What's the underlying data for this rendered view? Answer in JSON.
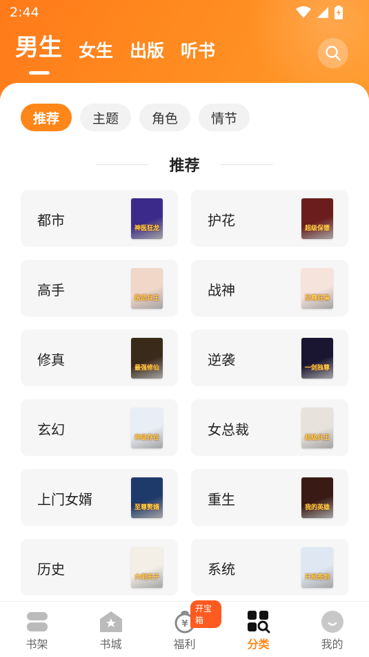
{
  "status": {
    "time": "2:44"
  },
  "tabs": [
    {
      "label": "男生",
      "active": true
    },
    {
      "label": "女生"
    },
    {
      "label": "出版"
    },
    {
      "label": "听书"
    }
  ],
  "chips": [
    {
      "label": "推荐",
      "active": true
    },
    {
      "label": "主题"
    },
    {
      "label": "角色"
    },
    {
      "label": "情节"
    }
  ],
  "section_title": "推荐",
  "categories": [
    {
      "label": "都市",
      "cover_text": "神医狂龙",
      "cover_color": "#3b2a8a"
    },
    {
      "label": "护花",
      "cover_text": "超级保镖",
      "cover_color": "#6b1d1d"
    },
    {
      "label": "高手",
      "cover_text": "医武兵王",
      "cover_color": "#f1d7c8"
    },
    {
      "label": "战神",
      "cover_text": "至尊狂枭",
      "cover_color": "#f6e3dc"
    },
    {
      "label": "修真",
      "cover_text": "最强修仙",
      "cover_color": "#3a2a1a"
    },
    {
      "label": "逆袭",
      "cover_text": "一剑独尊",
      "cover_color": "#1a1530"
    },
    {
      "label": "玄幻",
      "cover_text": "神级存在",
      "cover_color": "#e9eef6"
    },
    {
      "label": "女总裁",
      "cover_text": "超级兵王",
      "cover_color": "#e7e3dc"
    },
    {
      "label": "上门女婿",
      "cover_text": "至尊赘婿",
      "cover_color": "#1e3a6b"
    },
    {
      "label": "重生",
      "cover_text": "我的英雄",
      "cover_color": "#3a1a14"
    },
    {
      "label": "历史",
      "cover_text": "大明天子",
      "cover_color": "#f3efe6"
    },
    {
      "label": "系统",
      "cover_text": "开局签到",
      "cover_color": "#dfe8f2"
    }
  ],
  "nav": [
    {
      "label": "书架",
      "icon": "bookshelf-icon"
    },
    {
      "label": "书城",
      "icon": "store-icon"
    },
    {
      "label": "福利",
      "icon": "welfare-icon",
      "badge": "开宝箱"
    },
    {
      "label": "分类",
      "icon": "category-icon",
      "active": true
    },
    {
      "label": "我的",
      "icon": "profile-icon"
    }
  ],
  "colors": {
    "accent": "#ff8618",
    "header": "#ff7a1a"
  }
}
